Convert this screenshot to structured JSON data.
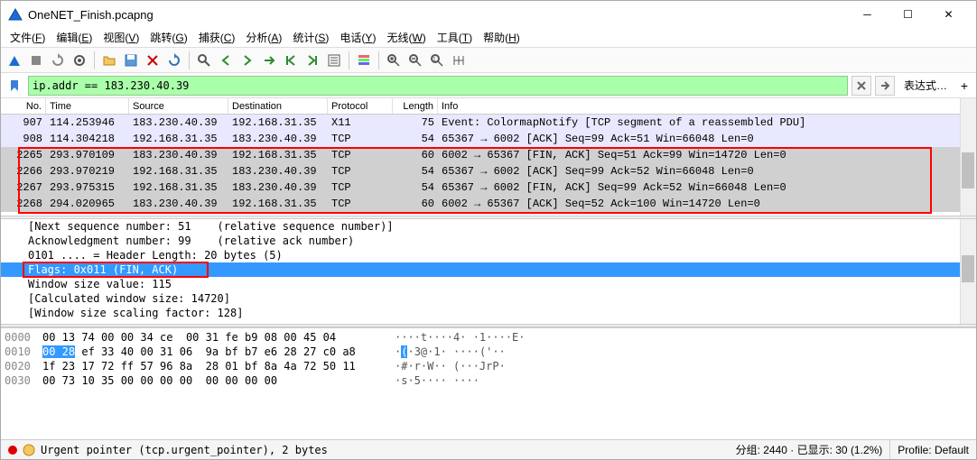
{
  "window": {
    "title": "OneNET_Finish.pcapng"
  },
  "menu": {
    "items": [
      {
        "label": "文件",
        "accel": "F"
      },
      {
        "label": "编辑",
        "accel": "E"
      },
      {
        "label": "视图",
        "accel": "V"
      },
      {
        "label": "跳转",
        "accel": "G"
      },
      {
        "label": "捕获",
        "accel": "C"
      },
      {
        "label": "分析",
        "accel": "A"
      },
      {
        "label": "统计",
        "accel": "S"
      },
      {
        "label": "电话",
        "accel": "Y"
      },
      {
        "label": "无线",
        "accel": "W"
      },
      {
        "label": "工具",
        "accel": "T"
      },
      {
        "label": "帮助",
        "accel": "H"
      }
    ]
  },
  "filter": {
    "text": "ip.addr == 183.230.40.39",
    "expr_label": "表达式…"
  },
  "packet_headers": [
    "No.",
    "Time",
    "Source",
    "Destination",
    "Protocol",
    "Length",
    "Info"
  ],
  "packets": [
    {
      "no": "907",
      "time": "114.253946",
      "src": "183.230.40.39",
      "dst": "192.168.31.35",
      "proto": "X11",
      "len": "75",
      "info": "Event: ColormapNotify [TCP segment of a reassembled PDU]",
      "cls": "lav"
    },
    {
      "no": "908",
      "time": "114.304218",
      "src": "192.168.31.35",
      "dst": "183.230.40.39",
      "proto": "TCP",
      "len": "54",
      "info": "65367 → 6002 [ACK] Seq=99 Ack=51 Win=66048 Len=0",
      "cls": "lav"
    },
    {
      "no": "2265",
      "time": "293.970109",
      "src": "183.230.40.39",
      "dst": "192.168.31.35",
      "proto": "TCP",
      "len": "60",
      "info": "6002 → 65367 [FIN, ACK] Seq=51 Ack=99 Win=14720 Len=0",
      "cls": "grey"
    },
    {
      "no": "2266",
      "time": "293.970219",
      "src": "192.168.31.35",
      "dst": "183.230.40.39",
      "proto": "TCP",
      "len": "54",
      "info": "65367 → 6002 [ACK] Seq=99 Ack=52 Win=66048 Len=0",
      "cls": "grey"
    },
    {
      "no": "2267",
      "time": "293.975315",
      "src": "192.168.31.35",
      "dst": "183.230.40.39",
      "proto": "TCP",
      "len": "54",
      "info": "65367 → 6002 [FIN, ACK] Seq=99 Ack=52 Win=66048 Len=0",
      "cls": "grey"
    },
    {
      "no": "2268",
      "time": "294.020965",
      "src": "183.230.40.39",
      "dst": "192.168.31.35",
      "proto": "TCP",
      "len": "60",
      "info": "6002 → 65367 [ACK] Seq=52 Ack=100 Win=14720 Len=0",
      "cls": "grey"
    }
  ],
  "details": [
    {
      "text": "[Next sequence number: 51    (relative sequence number)]",
      "sel": false
    },
    {
      "text": "Acknowledgment number: 99    (relative ack number)",
      "sel": false
    },
    {
      "text": "0101 .... = Header Length: 20 bytes (5)",
      "sel": false
    },
    {
      "text": "Flags: 0x011 (FIN, ACK)",
      "sel": true
    },
    {
      "text": "Window size value: 115",
      "sel": false
    },
    {
      "text": "[Calculated window size: 14720]",
      "sel": false
    },
    {
      "text": "[Window size scaling factor: 128]",
      "sel": false
    }
  ],
  "hex": [
    {
      "off": "0000",
      "b1": "00 13 74 00 00 34 ce ",
      "b2": " 00 31 fe b9 08 00 45 04",
      "ascii": "····t····4· ·1····E·"
    },
    {
      "off": "0010",
      "sel": "00 28",
      "b1": " ef 33 40 00 31 06 ",
      "b2": " 9a bf b7 e6 28 27 c0 a8",
      "ascii_pre": "·",
      "ascii_sel": "(",
      "ascii_post": "·3@·1· ····('··"
    },
    {
      "off": "0020",
      "b1": "1f 23 17 72 ff 57 96 8a ",
      "b2": " 28 01 bf 8a 4a 72 50 11",
      "ascii": "·#·r·W·· (···JrP·"
    },
    {
      "off": "0030",
      "b1": "00 73 10 35 00 00 00 00 ",
      "b2": " 00 00 00 00",
      "ascii": "·s·5···· ····"
    }
  ],
  "status": {
    "hint": "Urgent pointer (tcp.urgent_pointer), 2 bytes",
    "pkts": "分组: 2440 · 已显示: 30 (1.2%)",
    "profile": "Profile: Default"
  }
}
